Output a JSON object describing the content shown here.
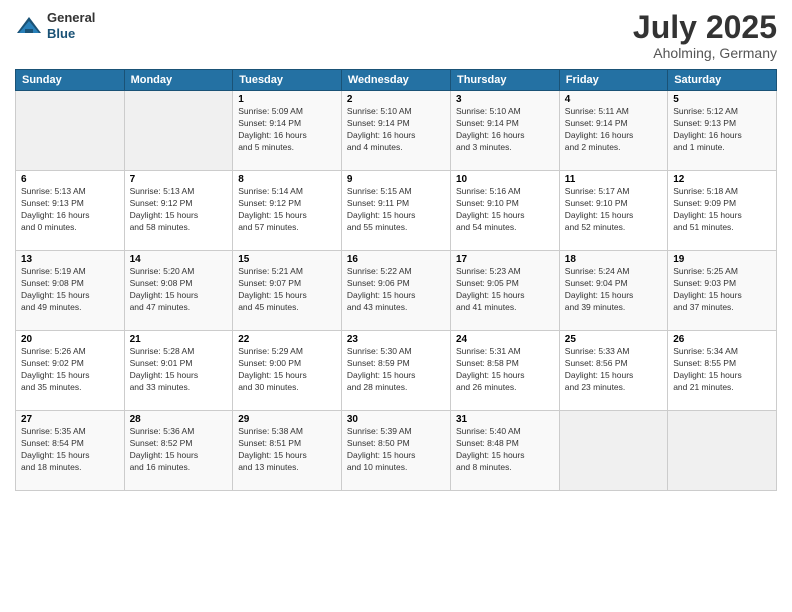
{
  "header": {
    "logo_line1": "General",
    "logo_line2": "Blue",
    "month_title": "July 2025",
    "location": "Aholming, Germany"
  },
  "calendar": {
    "days_of_week": [
      "Sunday",
      "Monday",
      "Tuesday",
      "Wednesday",
      "Thursday",
      "Friday",
      "Saturday"
    ],
    "weeks": [
      [
        {
          "day": "",
          "info": ""
        },
        {
          "day": "",
          "info": ""
        },
        {
          "day": "1",
          "info": "Sunrise: 5:09 AM\nSunset: 9:14 PM\nDaylight: 16 hours\nand 5 minutes."
        },
        {
          "day": "2",
          "info": "Sunrise: 5:10 AM\nSunset: 9:14 PM\nDaylight: 16 hours\nand 4 minutes."
        },
        {
          "day": "3",
          "info": "Sunrise: 5:10 AM\nSunset: 9:14 PM\nDaylight: 16 hours\nand 3 minutes."
        },
        {
          "day": "4",
          "info": "Sunrise: 5:11 AM\nSunset: 9:14 PM\nDaylight: 16 hours\nand 2 minutes."
        },
        {
          "day": "5",
          "info": "Sunrise: 5:12 AM\nSunset: 9:13 PM\nDaylight: 16 hours\nand 1 minute."
        }
      ],
      [
        {
          "day": "6",
          "info": "Sunrise: 5:13 AM\nSunset: 9:13 PM\nDaylight: 16 hours\nand 0 minutes."
        },
        {
          "day": "7",
          "info": "Sunrise: 5:13 AM\nSunset: 9:12 PM\nDaylight: 15 hours\nand 58 minutes."
        },
        {
          "day": "8",
          "info": "Sunrise: 5:14 AM\nSunset: 9:12 PM\nDaylight: 15 hours\nand 57 minutes."
        },
        {
          "day": "9",
          "info": "Sunrise: 5:15 AM\nSunset: 9:11 PM\nDaylight: 15 hours\nand 55 minutes."
        },
        {
          "day": "10",
          "info": "Sunrise: 5:16 AM\nSunset: 9:10 PM\nDaylight: 15 hours\nand 54 minutes."
        },
        {
          "day": "11",
          "info": "Sunrise: 5:17 AM\nSunset: 9:10 PM\nDaylight: 15 hours\nand 52 minutes."
        },
        {
          "day": "12",
          "info": "Sunrise: 5:18 AM\nSunset: 9:09 PM\nDaylight: 15 hours\nand 51 minutes."
        }
      ],
      [
        {
          "day": "13",
          "info": "Sunrise: 5:19 AM\nSunset: 9:08 PM\nDaylight: 15 hours\nand 49 minutes."
        },
        {
          "day": "14",
          "info": "Sunrise: 5:20 AM\nSunset: 9:08 PM\nDaylight: 15 hours\nand 47 minutes."
        },
        {
          "day": "15",
          "info": "Sunrise: 5:21 AM\nSunset: 9:07 PM\nDaylight: 15 hours\nand 45 minutes."
        },
        {
          "day": "16",
          "info": "Sunrise: 5:22 AM\nSunset: 9:06 PM\nDaylight: 15 hours\nand 43 minutes."
        },
        {
          "day": "17",
          "info": "Sunrise: 5:23 AM\nSunset: 9:05 PM\nDaylight: 15 hours\nand 41 minutes."
        },
        {
          "day": "18",
          "info": "Sunrise: 5:24 AM\nSunset: 9:04 PM\nDaylight: 15 hours\nand 39 minutes."
        },
        {
          "day": "19",
          "info": "Sunrise: 5:25 AM\nSunset: 9:03 PM\nDaylight: 15 hours\nand 37 minutes."
        }
      ],
      [
        {
          "day": "20",
          "info": "Sunrise: 5:26 AM\nSunset: 9:02 PM\nDaylight: 15 hours\nand 35 minutes."
        },
        {
          "day": "21",
          "info": "Sunrise: 5:28 AM\nSunset: 9:01 PM\nDaylight: 15 hours\nand 33 minutes."
        },
        {
          "day": "22",
          "info": "Sunrise: 5:29 AM\nSunset: 9:00 PM\nDaylight: 15 hours\nand 30 minutes."
        },
        {
          "day": "23",
          "info": "Sunrise: 5:30 AM\nSunset: 8:59 PM\nDaylight: 15 hours\nand 28 minutes."
        },
        {
          "day": "24",
          "info": "Sunrise: 5:31 AM\nSunset: 8:58 PM\nDaylight: 15 hours\nand 26 minutes."
        },
        {
          "day": "25",
          "info": "Sunrise: 5:33 AM\nSunset: 8:56 PM\nDaylight: 15 hours\nand 23 minutes."
        },
        {
          "day": "26",
          "info": "Sunrise: 5:34 AM\nSunset: 8:55 PM\nDaylight: 15 hours\nand 21 minutes."
        }
      ],
      [
        {
          "day": "27",
          "info": "Sunrise: 5:35 AM\nSunset: 8:54 PM\nDaylight: 15 hours\nand 18 minutes."
        },
        {
          "day": "28",
          "info": "Sunrise: 5:36 AM\nSunset: 8:52 PM\nDaylight: 15 hours\nand 16 minutes."
        },
        {
          "day": "29",
          "info": "Sunrise: 5:38 AM\nSunset: 8:51 PM\nDaylight: 15 hours\nand 13 minutes."
        },
        {
          "day": "30",
          "info": "Sunrise: 5:39 AM\nSunset: 8:50 PM\nDaylight: 15 hours\nand 10 minutes."
        },
        {
          "day": "31",
          "info": "Sunrise: 5:40 AM\nSunset: 8:48 PM\nDaylight: 15 hours\nand 8 minutes."
        },
        {
          "day": "",
          "info": ""
        },
        {
          "day": "",
          "info": ""
        }
      ]
    ]
  }
}
